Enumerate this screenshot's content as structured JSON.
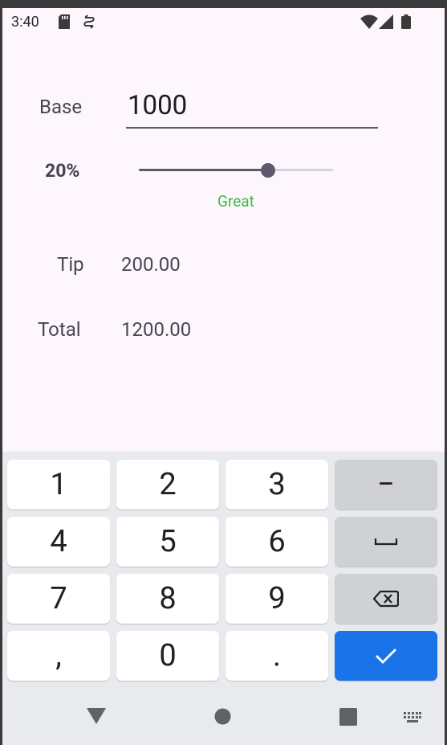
{
  "status_bar": {
    "time": "3:40",
    "left_icons": [
      "sd-card-icon",
      "sync-icon"
    ],
    "right_icons": [
      "wifi-icon",
      "cell-signal-icon",
      "battery-icon"
    ]
  },
  "form": {
    "base_label": "Base",
    "base_value": "1000",
    "tip_percent": "20%",
    "slider_value": 20,
    "slider_min": 0,
    "slider_max": 30,
    "rating": "Great",
    "rating_color": "#3cbf3c",
    "tip_label": "Tip",
    "tip_value": "200.00",
    "total_label": "Total",
    "total_value": "1200.00"
  },
  "keyboard": {
    "keys": [
      "1",
      "2",
      "3",
      "−",
      "4",
      "5",
      "6",
      "space",
      "7",
      "8",
      "9",
      "backspace",
      ",",
      "0",
      ".",
      "done"
    ],
    "digit_1": "1",
    "digit_2": "2",
    "digit_3": "3",
    "minus": "−",
    "digit_4": "4",
    "digit_5": "5",
    "digit_6": "6",
    "digit_7": "7",
    "digit_8": "8",
    "digit_9": "9",
    "comma": ",",
    "digit_0": "0",
    "period": ".",
    "accent_color": "#1a73e8"
  },
  "nav_bar": {
    "icons": [
      "back-icon",
      "home-icon",
      "recents-icon",
      "keyboard-switch-icon"
    ]
  }
}
